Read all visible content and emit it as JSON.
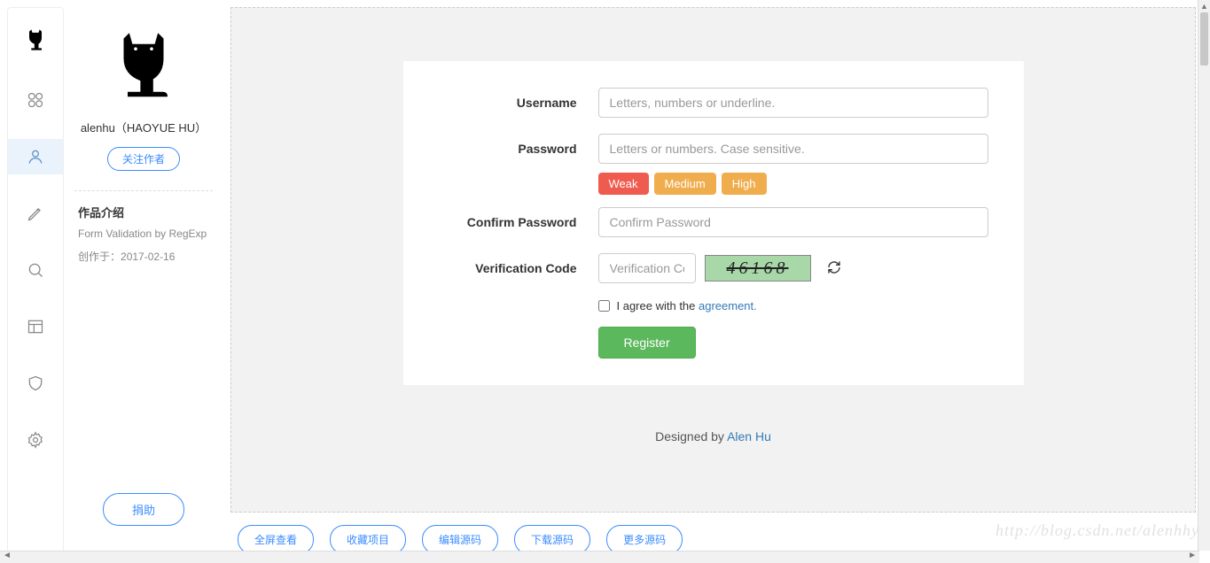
{
  "sidebar": {
    "author_name": "alenhu（HAOYUE HU）",
    "follow_label": "关注作者",
    "intro_title": "作品介绍",
    "intro_desc": "Form Validation by RegExp",
    "created_prefix": "创作于：",
    "created_date": "2017-02-16",
    "donate_label": "捐助"
  },
  "form": {
    "username_label": "Username",
    "username_placeholder": "Letters, numbers or underline.",
    "password_label": "Password",
    "password_placeholder": "Letters or numbers. Case sensitive.",
    "strength": {
      "weak": "Weak",
      "medium": "Medium",
      "high": "High"
    },
    "confirm_label": "Confirm Password",
    "confirm_placeholder": "Confirm Password",
    "code_label": "Verification Code",
    "code_placeholder": "Verification Co",
    "captcha_value": "46168",
    "agree_prefix": "I agree with the ",
    "agree_link": "agreement.",
    "register_label": "Register",
    "designed_prefix": "Designed by ",
    "designed_name": "Alen Hu"
  },
  "actions": {
    "fullscreen": "全屏查看",
    "favorite": "收藏项目",
    "edit_source": "编辑源码",
    "download_source": "下载源码",
    "more_source": "更多源码"
  },
  "watermark": "http://blog.csdn.net/alenhhy"
}
